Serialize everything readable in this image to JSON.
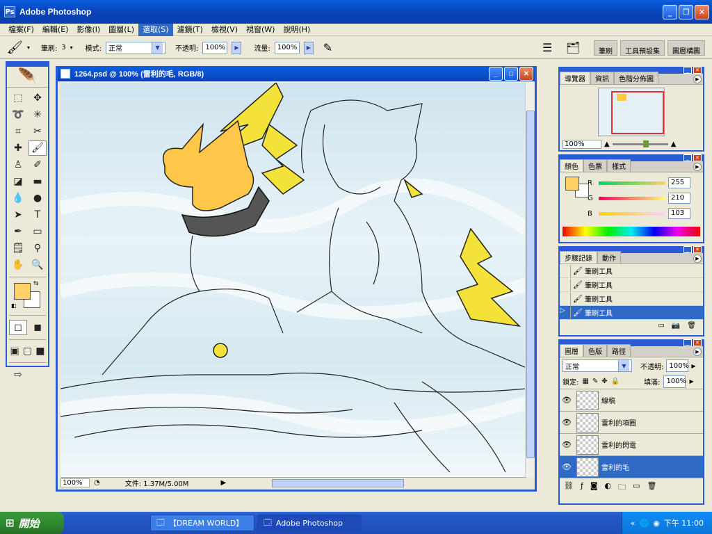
{
  "app": {
    "title": "Adobe Photoshop"
  },
  "menu": [
    "檔案(F)",
    "編輯(E)",
    "影像(I)",
    "圖層(L)",
    "選取(S)",
    "濾鏡(T)",
    "檢視(V)",
    "視窗(W)",
    "說明(H)"
  ],
  "options": {
    "brush_label": "筆刷:",
    "brush_size": "3",
    "mode_label": "模式:",
    "mode_value": "正常",
    "opacity_label": "不透明:",
    "opacity_value": "100%",
    "flow_label": "流量:",
    "flow_value": "100%"
  },
  "well_tabs": [
    "筆刷",
    "工具預設集",
    "圖層構圖"
  ],
  "document": {
    "title": "1264.psd @ 100% (雷利的毛, RGB/8)",
    "zoom": "100%",
    "file_info": "文件: 1.37M/5.00M"
  },
  "navigator": {
    "tabs": [
      "導覽器",
      "資訊",
      "色階分佈圖"
    ],
    "zoom": "100%"
  },
  "color_panel": {
    "tabs": [
      "顏色",
      "色票",
      "樣式"
    ],
    "fg_color": "#ffd267",
    "channels": [
      {
        "label": "R",
        "value": "255"
      },
      {
        "label": "G",
        "value": "210"
      },
      {
        "label": "B",
        "value": "103"
      }
    ]
  },
  "history": {
    "tabs": [
      "步驟記錄",
      "動作"
    ],
    "items": [
      "筆刷工具",
      "筆刷工具",
      "筆刷工具",
      "筆刷工具"
    ]
  },
  "layers": {
    "tabs": [
      "圖層",
      "色版",
      "路徑"
    ],
    "blend_mode": "正常",
    "opacity_label": "不透明:",
    "opacity_value": "100%",
    "lock_label": "鎖定:",
    "fill_label": "填滿:",
    "fill_value": "100%",
    "items": [
      "線稿",
      "雷利的項圈",
      "雷利的閃電",
      "雷利的毛"
    ]
  },
  "taskbar": {
    "start": "開始",
    "tasks": [
      "【DREAM WORLD】",
      "Adobe Photoshop"
    ],
    "clock": "下午 11:00"
  }
}
